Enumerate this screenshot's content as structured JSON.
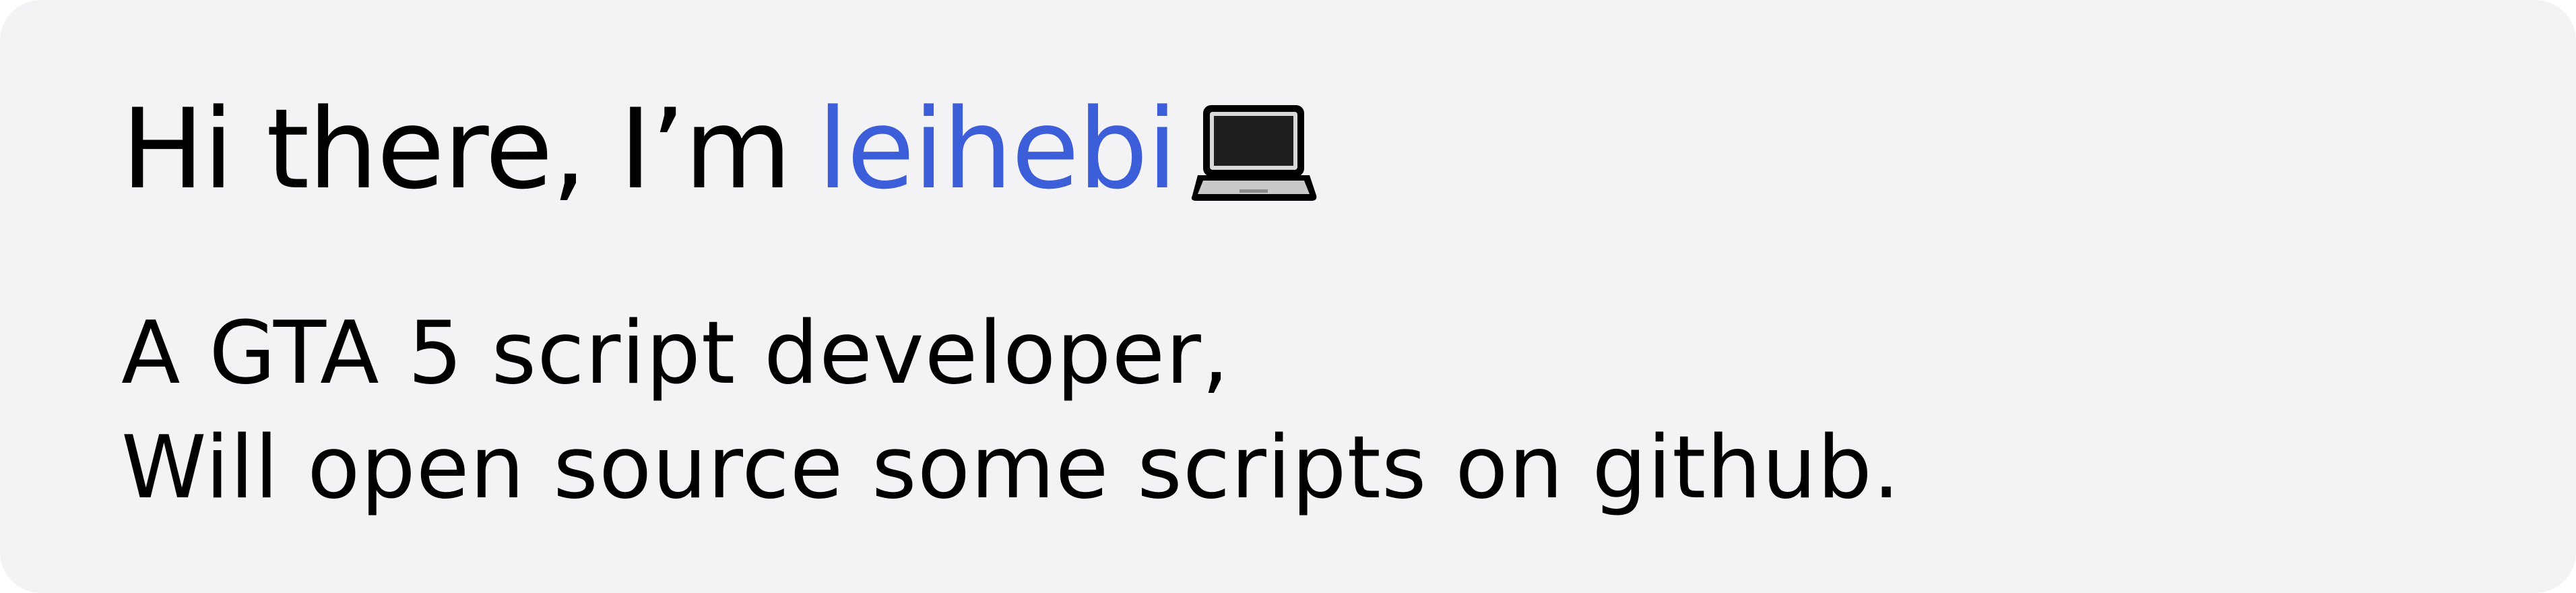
{
  "greeting": {
    "prefix": "Hi there, I’m",
    "name": "leihebi",
    "icon": "laptop-icon"
  },
  "bio": {
    "line1": "A GTA 5 script developer,",
    "line2": "Will open source some scripts on github."
  },
  "colors": {
    "background": "#f3f3f6",
    "accent": "#3c5ed8",
    "text": "#000000"
  }
}
